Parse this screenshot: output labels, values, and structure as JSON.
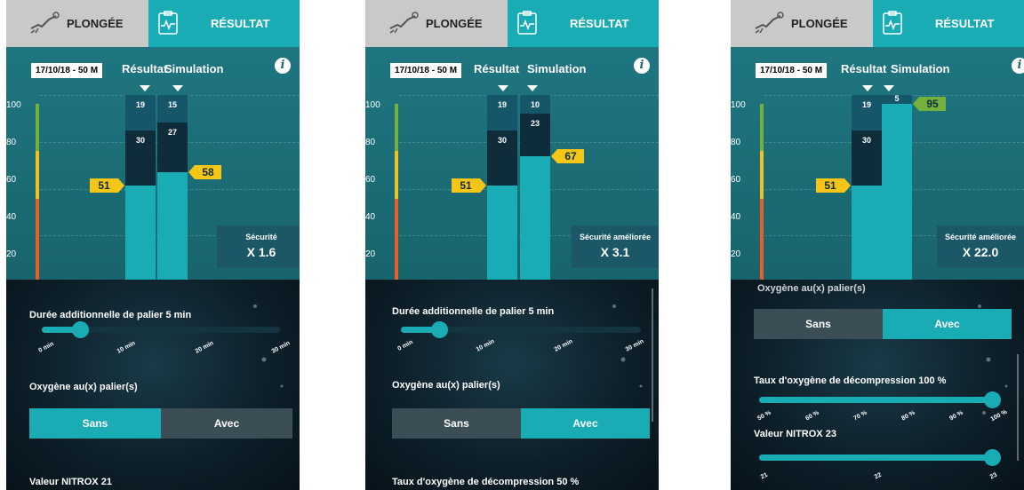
{
  "tabs": {
    "plongee": "PLONGÉE",
    "resultat": "RÉSULTAT"
  },
  "colors": {
    "teal": "#1aacb4",
    "badge_yellow": "#f5c518",
    "badge_green": "#74b13c",
    "gauge_red": "#e85e2a",
    "gauge_yellow": "#f0c21b",
    "gauge_green": "#74b13c"
  },
  "icons": [
    "diver-icon",
    "chart-clipboard-icon",
    "info-icon"
  ],
  "chart_data": [
    {
      "type": "bar",
      "y_ticks": [
        "100",
        "80",
        "60",
        "40",
        "20"
      ],
      "ylim": [
        0,
        100
      ],
      "categories": [
        "Résultat",
        "Simulation"
      ],
      "bars": [
        {
          "base": 51,
          "mid": 30,
          "top": 19,
          "marker": "51"
        },
        {
          "base": 58,
          "mid": 27,
          "top": 15,
          "marker": "58"
        }
      ]
    },
    {
      "type": "bar",
      "y_ticks": [
        "100",
        "80",
        "60",
        "40",
        "20"
      ],
      "ylim": [
        0,
        100
      ],
      "categories": [
        "Résultat",
        "Simulation"
      ],
      "bars": [
        {
          "base": 51,
          "mid": 30,
          "top": 19,
          "marker": "51"
        },
        {
          "base": 67,
          "mid": 23,
          "top": 10,
          "marker": "67"
        }
      ]
    },
    {
      "type": "bar",
      "y_ticks": [
        "100",
        "80",
        "60",
        "40",
        "20"
      ],
      "ylim": [
        0,
        100
      ],
      "categories": [
        "Résultat",
        "Simulation"
      ],
      "bars": [
        {
          "base": 51,
          "mid": 30,
          "top": 19,
          "marker": "51"
        },
        {
          "base": 95,
          "mid": 0,
          "top": 5,
          "marker": "95"
        }
      ]
    }
  ],
  "screens": [
    {
      "date": "17/10/18 - 50 M",
      "result_label": "Résultat",
      "sim_label": "Simulation",
      "security_label": "Sécurité",
      "security_value": "X 1.6",
      "lower": {
        "stop_label": "Durée additionnelle de palier",
        "stop_value": "5",
        "stop_unit": "min",
        "stop_fraction": 0.16,
        "stop_ticks": [
          "0 min",
          "10 min",
          "20 min",
          "30 min"
        ],
        "oxygen_label": "Oxygène au(x) palier(s)",
        "toggle_sans": "Sans",
        "toggle_avec": "Avec",
        "toggle_selected": "Sans",
        "nitrox_label": "Valeur NITROX",
        "nitrox_value": "21"
      }
    },
    {
      "date": "17/10/18 - 50 M",
      "result_label": "Résultat",
      "sim_label": "Simulation",
      "security_label": "Sécurité améliorée",
      "security_value": "X 3.1",
      "lower": {
        "stop_label": "Durée additionnelle de palier",
        "stop_value": "5",
        "stop_unit": "min",
        "stop_fraction": 0.16,
        "stop_ticks": [
          "0 min",
          "10 min",
          "20 min",
          "30 min"
        ],
        "oxygen_label": "Oxygène au(x) palier(s)",
        "toggle_sans": "Sans",
        "toggle_avec": "Avec",
        "toggle_selected": "Avec",
        "taux_label": "Taux d'oxygène de décompression",
        "taux_value": "50",
        "taux_unit": "%"
      }
    },
    {
      "date": "17/10/18 - 50 M",
      "result_label": "Résultat",
      "sim_label": "Simulation",
      "security_label": "Sécurité améliorée",
      "security_value": "X 22.0",
      "lower": {
        "oxygen_label": "Oxygène au(x) palier(s)",
        "toggle_sans": "Sans",
        "toggle_avec": "Avec",
        "toggle_selected": "Avec",
        "taux_label": "Taux d'oxygène de décompression",
        "taux_value": "100",
        "taux_unit": "%",
        "taux_fraction": 1.0,
        "taux_ticks": [
          "50 %",
          "60 %",
          "70 %",
          "80 %",
          "90 %",
          "100 %"
        ],
        "nitrox_label": "Valeur NITROX",
        "nitrox_value": "23",
        "nitrox_fraction": 1.0,
        "nitrox_ticks": [
          "21",
          "22",
          "23"
        ]
      }
    }
  ]
}
